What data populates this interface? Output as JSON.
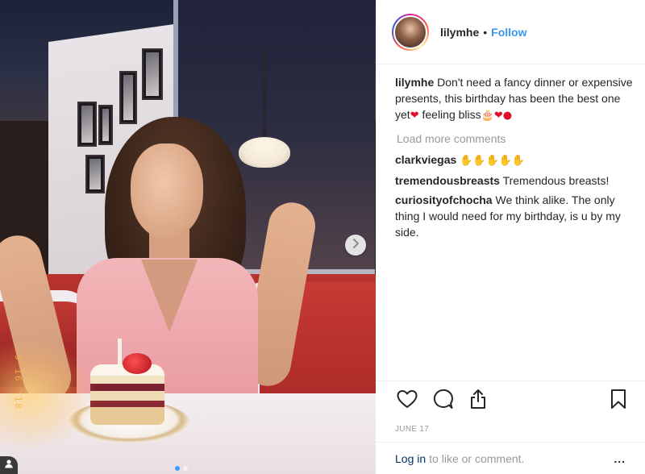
{
  "post": {
    "author": "lilymhe",
    "follow_label": "Follow",
    "separator": "•",
    "date": "JUNE 17",
    "photo_date_stamp": "9 16 '18",
    "carousel": {
      "count": 2,
      "active_index": 0
    }
  },
  "caption": {
    "user": "lilymhe",
    "text_1": "Don't need a fancy dinner or expensive presents, this birthday has been the best one yet",
    "text_2": " feeling bliss"
  },
  "load_more_label": "Load more comments",
  "comments": [
    {
      "user": "clarkviegas",
      "text": ""
    },
    {
      "user": "tremendousbreasts",
      "text": "Tremendous breasts!"
    },
    {
      "user": "curiosityofchocha",
      "text": "We think alike. The only thing I would need for my birthday, is u by my side."
    }
  ],
  "footer": {
    "login_label": "Log in",
    "rest_label": "to like or comment.",
    "more_label": "..."
  },
  "icons": {
    "like": "heart-outline-icon",
    "comment": "speech-bubble-icon",
    "share": "share-upload-icon",
    "save": "bookmark-icon",
    "next": "chevron-right-icon",
    "tag": "user-tag-icon"
  },
  "colors": {
    "link_blue": "#3897f0",
    "login_blue": "#003569",
    "muted": "#999999",
    "text": "#262626",
    "heart_red": "#e0112b"
  }
}
